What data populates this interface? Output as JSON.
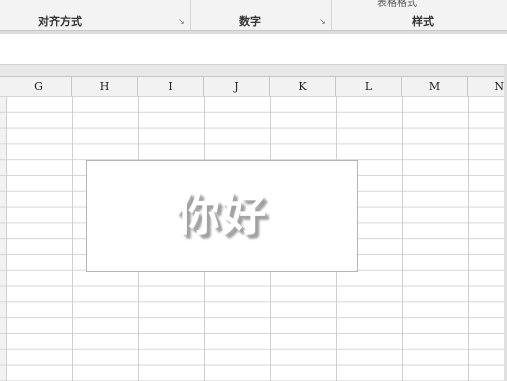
{
  "ribbon": {
    "group_alignment": "对齐方式",
    "group_number": "数字",
    "group_styles": "样式",
    "styles_cut_text": "表格格式",
    "launcher_glyph": "↘"
  },
  "column_headers": [
    "G",
    "H",
    "I",
    "J",
    "K",
    "L",
    "M",
    "N"
  ],
  "textbox": {
    "text": "你好"
  },
  "colors": {
    "ribbon_bg": "#f3f3f3",
    "grid_line": "#d0d0d0",
    "header_bg": "#f2f2f2"
  }
}
